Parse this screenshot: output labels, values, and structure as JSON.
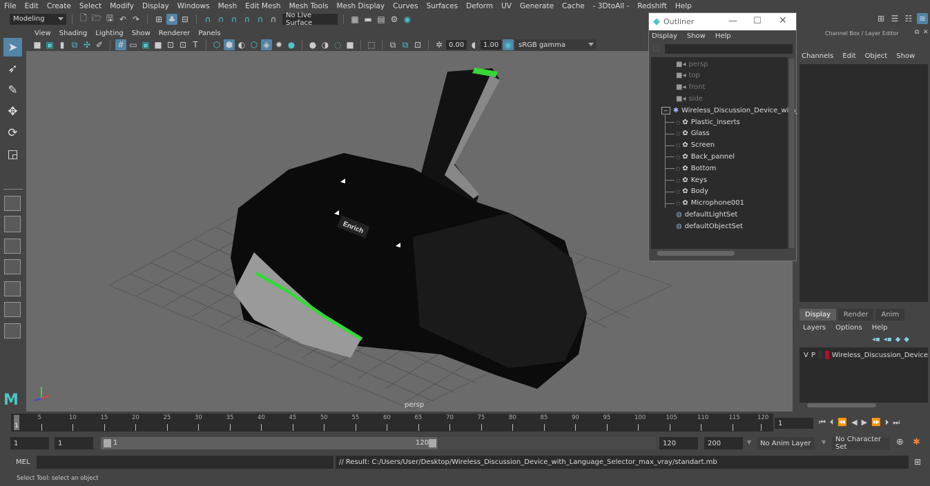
{
  "menubar": [
    "File",
    "Edit",
    "Create",
    "Select",
    "Modify",
    "Display",
    "Windows",
    "Mesh",
    "Edit Mesh",
    "Mesh Tools",
    "Mesh Display",
    "Curves",
    "Surfaces",
    "Deform",
    "UV",
    "Generate",
    "Cache",
    "- 3DtoAll -",
    "Redshift",
    "Help"
  ],
  "shelf": {
    "mode": "Modeling",
    "live_surface": "No Live Surface"
  },
  "viewport": {
    "menu": [
      "View",
      "Shading",
      "Lighting",
      "Show",
      "Renderer",
      "Panels"
    ],
    "exposure": "0.00",
    "gamma": "1.00",
    "color_space": "sRGB gamma",
    "camera_label": "persp",
    "logo_text": "Enrich"
  },
  "outliner": {
    "title": "Outliner",
    "menu": [
      "Display",
      "Show",
      "Help"
    ],
    "search_value": "",
    "cameras": [
      "persp",
      "top",
      "front",
      "side"
    ],
    "group": "Wireless_Discussion_Device_with_",
    "children": [
      "Plastic_inserts",
      "Glass",
      "Screen",
      "Back_pannel",
      "Bottom",
      "Keys",
      "Body",
      "Microphone001"
    ],
    "sets": [
      "defaultLightSet",
      "defaultObjectSet"
    ]
  },
  "channelbox": {
    "title": "Channel Box / Layer Editor",
    "menu": [
      "Channels",
      "Edit",
      "Object",
      "Show"
    ],
    "layer_tabs": [
      "Display",
      "Render",
      "Anim"
    ],
    "active_tab": "Display",
    "layer_menu": [
      "Layers",
      "Options",
      "Help"
    ],
    "layer": {
      "v": "V",
      "p": "P",
      "name": "Wireless_Discussion_Device",
      "color": "#b0102a"
    }
  },
  "timeline": {
    "ticks": [
      "5",
      "10",
      "15",
      "20",
      "25",
      "30",
      "35",
      "40",
      "45",
      "50",
      "55",
      "60",
      "65",
      "70",
      "75",
      "80",
      "85",
      "90",
      "95",
      "100",
      "105",
      "110",
      "115",
      "120"
    ],
    "current_frame_marker": "1",
    "current_frame": "1"
  },
  "range": {
    "start": "1",
    "playback_start": "1",
    "slider_start": "1",
    "slider_end": "120",
    "playback_end": "120",
    "end": "200",
    "anim_layer": "No Anim Layer",
    "character_set": "No Character Set"
  },
  "command": {
    "lang": "MEL",
    "input": "",
    "result": "// Result: C:/Users/User/Desktop/Wireless_Discussion_Device_with_Language_Selector_max_vray/standart.mb"
  },
  "help_line": "Select Tool: select an object",
  "colors": {
    "accent": "#5285a6",
    "teal": "#4cc4c8",
    "device_green": "#39d63a"
  }
}
